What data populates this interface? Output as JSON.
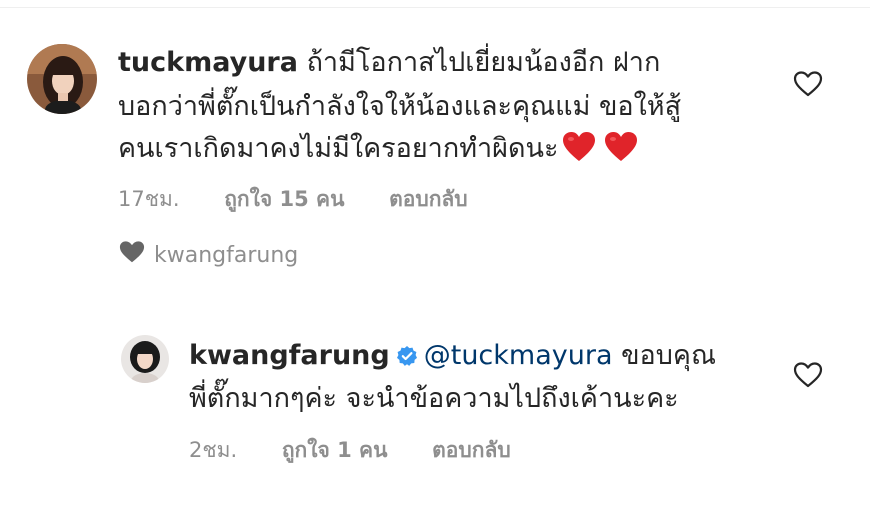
{
  "comment1": {
    "username": "tuckmayura",
    "text_line1": "ถ้ามีโอกาสไปเยี่ยมน้องอีก ฝาก",
    "text_line2": "บอกว่าพี่ตั๊กเป็นกำลังใจให้น้องและคุณแม่ ขอให้สู้",
    "text_line3": "คนเราเกิดมาคงไม่มีใครอยากทำผิดนะ",
    "emojis": [
      "red-heart-emoji",
      "red-heart-emoji"
    ],
    "time": "17ชม.",
    "likes": "ถูกใจ 15 คน",
    "reply_label": "ตอบกลับ"
  },
  "liked_by": {
    "username": "kwangfarung"
  },
  "reply1": {
    "username": "kwangfarung",
    "verified": true,
    "mention": "@tuckmayura",
    "text_line1": "ขอบคุณ",
    "text_line2": "พี่ตั๊กมากๆค่ะ จะนำข้อความไปถึงเค้านะคะ",
    "time": "2ชม.",
    "likes": "ถูกใจ 1 คน",
    "reply_label": "ตอบกลับ"
  },
  "colors": {
    "text": "#262626",
    "secondary": "#8e8e8e",
    "mention": "#00376b",
    "verified": "#3897f0",
    "emoji_heart": "#e0242a"
  }
}
